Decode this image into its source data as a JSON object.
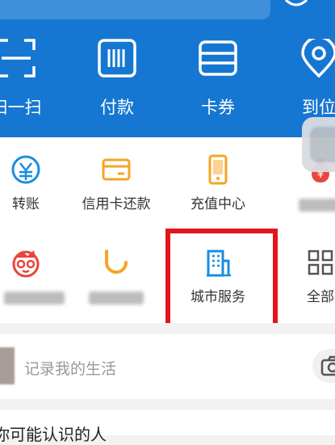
{
  "colors": {
    "header_bg": "#1677d2",
    "highlight": "#e3151a"
  },
  "quick_actions": [
    {
      "label": "扫一扫",
      "icon": "scan-icon"
    },
    {
      "label": "付款",
      "icon": "barcode-icon"
    },
    {
      "label": "卡券",
      "icon": "card-wallet-icon"
    },
    {
      "label": "到位",
      "icon": "location-pin-icon"
    }
  ],
  "services": [
    {
      "label": "转账",
      "icon": "transfer-icon"
    },
    {
      "label": "信用卡还款",
      "icon": "credit-card-icon"
    },
    {
      "label": "充值中心",
      "icon": "phone-topup-icon"
    },
    {
      "label": "",
      "icon": "money-bag-icon"
    },
    {
      "label": "",
      "icon": "red-face-icon"
    },
    {
      "label": "",
      "icon": "didi-icon"
    },
    {
      "label": "城市服务",
      "icon": "building-icon"
    },
    {
      "label": "全部",
      "icon": "grid-icon"
    }
  ],
  "life": {
    "placeholder": "记录我的生活",
    "icon": "camera-icon"
  },
  "people_section": {
    "title": "你可能认识的人"
  }
}
